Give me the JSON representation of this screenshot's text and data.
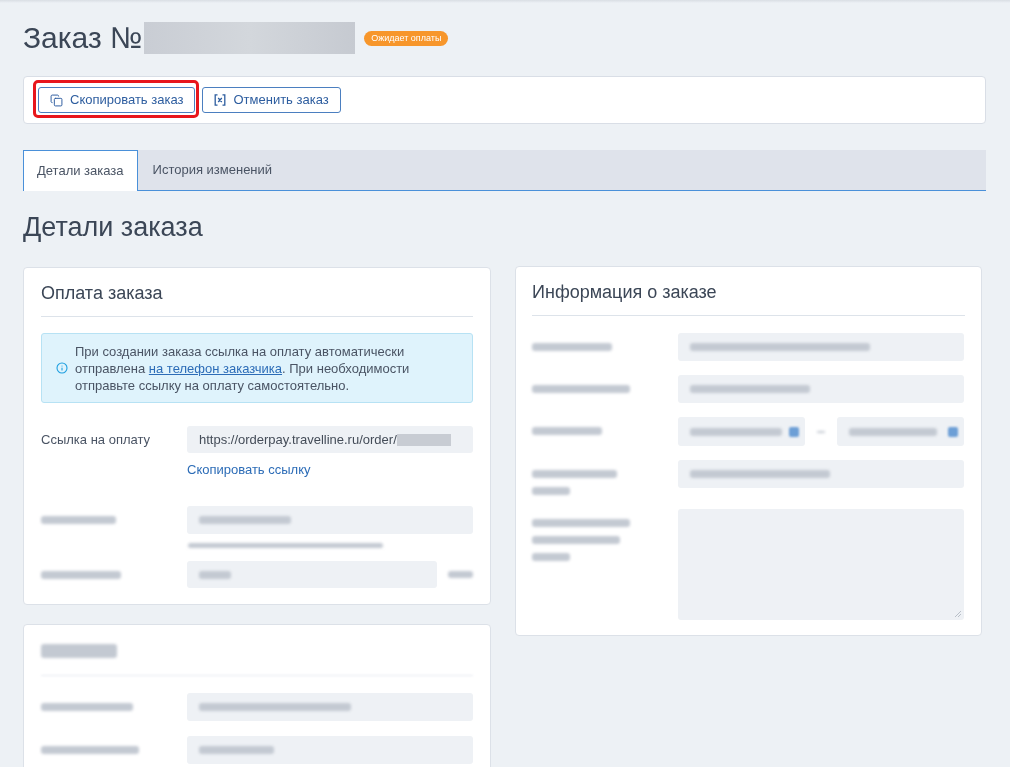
{
  "header": {
    "title": "Заказ №",
    "status_badge": "Ожидает оплаты"
  },
  "actions": [
    {
      "kind": "copy",
      "label": "Скопировать заказ",
      "highlighted": true
    },
    {
      "kind": "cancel",
      "label": "Отменить заказ",
      "highlighted": false
    }
  ],
  "tabs": [
    {
      "label": "Детали заказа",
      "selected": true
    },
    {
      "label": "История изменений",
      "selected": false
    }
  ],
  "page_heading": "Детали заказа",
  "payment_card": {
    "title": "Оплата заказа",
    "notice": {
      "text_before": "При создании заказа ссылка на оплату автоматически отправлена ",
      "link": "на телефон заказчика",
      "text_after": ". При необходимости отправьте ссылку на оплату самостоятельно."
    },
    "link_field": {
      "label": "Ссылка на оплату",
      "value": "https://orderpay.travelline.ru/order/",
      "action": "Скопировать ссылку"
    },
    "rows": [
      {
        "kind": "hinted"
      },
      {
        "kind": "suffixed"
      }
    ]
  },
  "customer_card": {
    "rows": [
      {
        "kind": "field"
      },
      {
        "kind": "field"
      }
    ]
  },
  "info_card": {
    "title": "Информация о заказе",
    "rows": [
      {
        "kind": "field"
      },
      {
        "kind": "field"
      },
      {
        "kind": "daterange"
      },
      {
        "kind": "twoline"
      },
      {
        "kind": "textarea"
      }
    ]
  }
}
